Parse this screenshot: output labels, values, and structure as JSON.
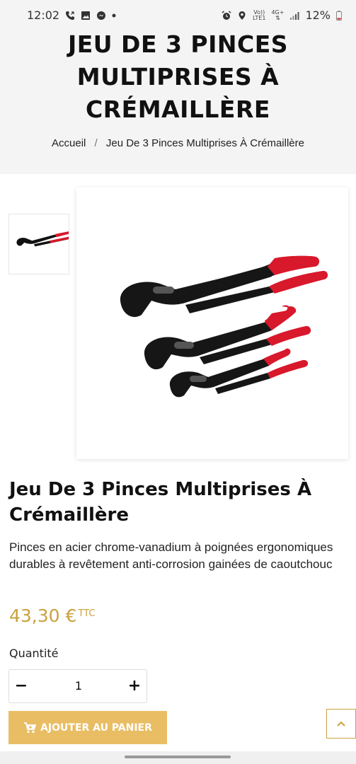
{
  "status_bar": {
    "time": "12:02",
    "network_top": "Vo))",
    "network_bottom": "LTE1",
    "signal_type": "4G+",
    "battery": "12%"
  },
  "header": {
    "title_line1": "JEU DE 3 PINCES",
    "title_line2": "MULTIPRISES À",
    "title_line3": "CRÉMAILLÈRE"
  },
  "breadcrumb": {
    "home": "Accueil",
    "separator": "/",
    "current": "Jeu De 3 Pinces Multiprises À Crémaillère"
  },
  "product": {
    "title_line1": "Jeu De 3 Pinces Multiprises À",
    "title_line2": "Crémaillère",
    "description": "Pinces en acier chrome-vanadium à poignées ergonomiques durables à revêtement anti-corrosion gainées de caoutchouc",
    "price": "43,30 €",
    "tax_label": "TTC",
    "quantity_label": "Quantité",
    "quantity_value": "1",
    "minus": "−",
    "plus": "+",
    "add_to_cart_label": "AJOUTER AU PANIER"
  },
  "colors": {
    "accent": "#e9bd63",
    "price": "#c9a23f",
    "handle_red": "#d8182b",
    "header_bg": "#f4f4f4"
  },
  "icons": {
    "cart": "cart-icon",
    "back_to_top": "chevron-up-icon"
  }
}
